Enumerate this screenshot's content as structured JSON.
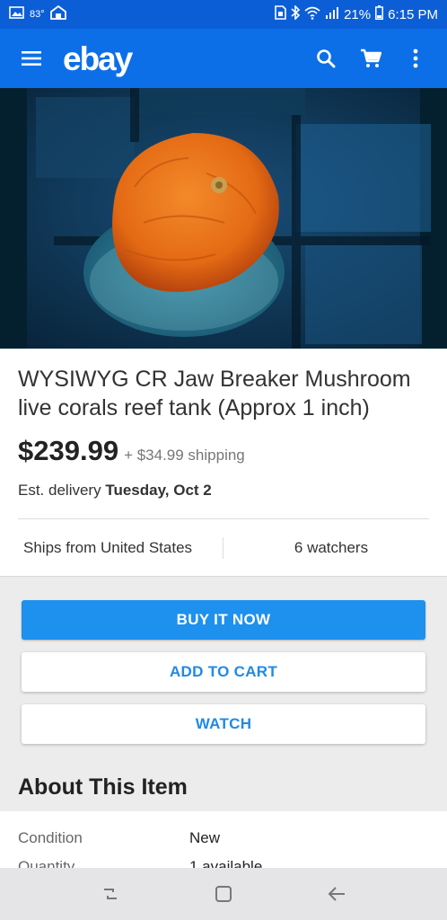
{
  "status": {
    "temperature": "83°",
    "battery": "21%",
    "time": "6:15 PM"
  },
  "app": {
    "logo": "ebay"
  },
  "listing": {
    "title": "WYSIWYG CR Jaw Breaker Mushroom live corals reef tank (Approx 1 inch)",
    "price": "$239.99",
    "shipping": "+ $34.99 shipping",
    "delivery_prefix": "Est. delivery",
    "delivery_date": "Tuesday, Oct 2",
    "ships_from": "Ships from United States",
    "watchers": "6 watchers"
  },
  "actions": {
    "buy": "BUY IT NOW",
    "cart": "ADD TO CART",
    "watch": "WATCH"
  },
  "about": {
    "title": "About This Item",
    "rows": [
      {
        "label": "Condition",
        "value": "New"
      },
      {
        "label": "Quantity",
        "value": "1 available"
      }
    ]
  },
  "icons": [
    "image-icon",
    "home-icon",
    "sim-icon",
    "bluetooth-icon",
    "wifi-icon",
    "signal-icon",
    "battery-icon",
    "menu-icon",
    "search-icon",
    "cart-icon",
    "more-icon",
    "recent-apps-icon",
    "home-button-icon",
    "back-icon"
  ]
}
